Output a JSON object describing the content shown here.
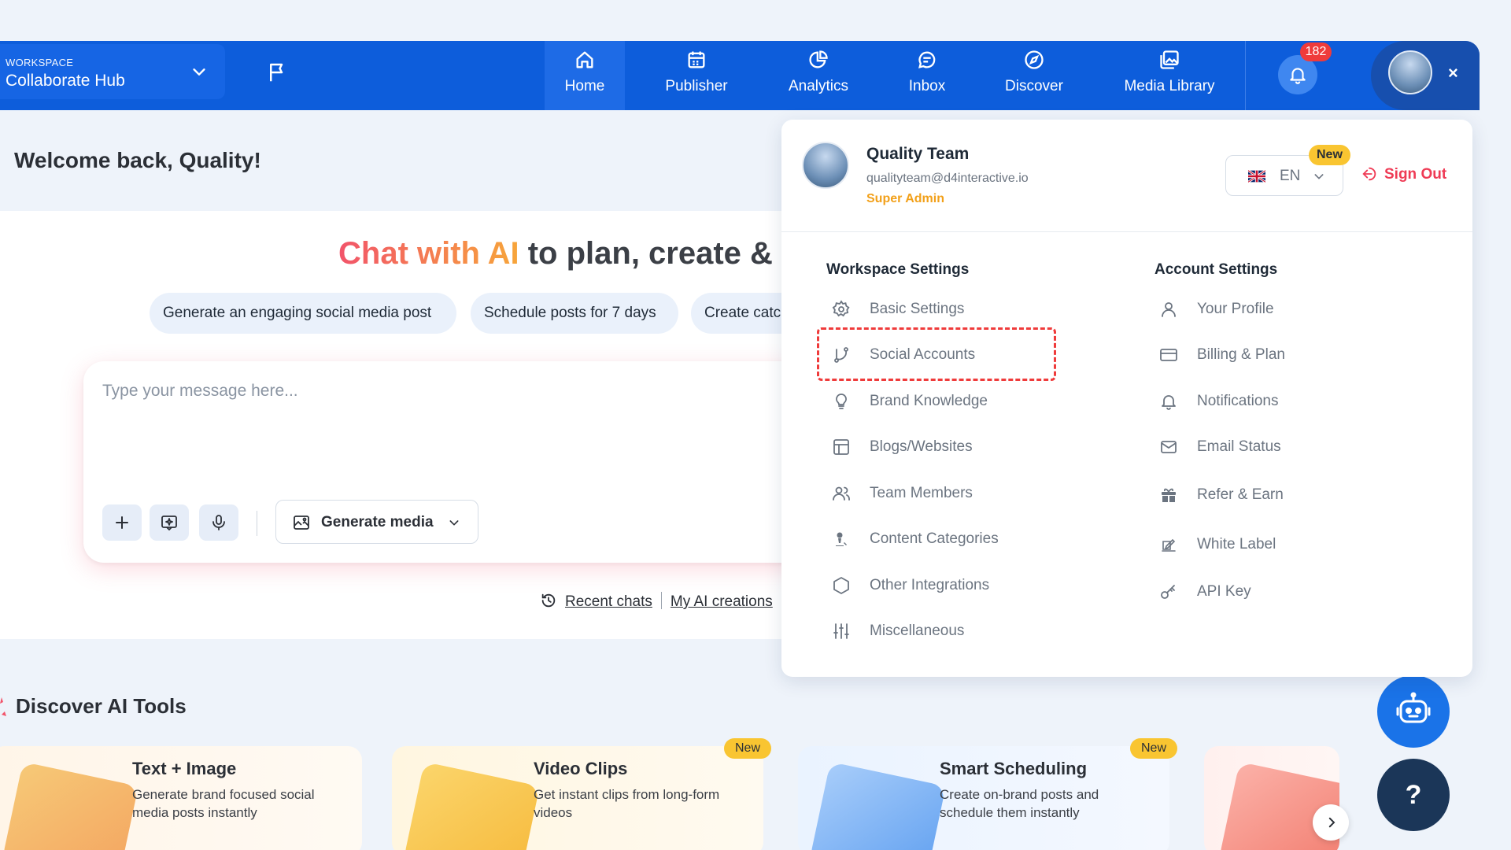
{
  "topbar": {
    "workspace_label": "WORKSPACE",
    "workspace_name": "Collaborate Hub",
    "nav": [
      {
        "label": "Home",
        "icon": "home-icon",
        "active": true
      },
      {
        "label": "Publisher",
        "icon": "calendar-icon"
      },
      {
        "label": "Analytics",
        "icon": "pie-chart-icon"
      },
      {
        "label": "Inbox",
        "icon": "chat-icon"
      },
      {
        "label": "Discover",
        "icon": "compass-icon"
      },
      {
        "label": "Media Library",
        "icon": "image-gallery-icon"
      }
    ],
    "notification_count": "182",
    "close_label": "×"
  },
  "main": {
    "welcome": "Welcome back, Quality!",
    "headline_accent": "Chat with AI",
    "headline_rest": " to plan, create & sc",
    "suggestions": [
      "Generate an engaging social media post",
      "Schedule posts for 7 days",
      "Create catc"
    ],
    "chat_placeholder": "Type your message here...",
    "generate_media_label": "Generate media",
    "recent_chats": "Recent chats",
    "my_ai_creations": "My AI creations"
  },
  "discover": {
    "title": "Discover AI Tools",
    "cards": [
      {
        "title": "Text + Image",
        "desc": "Generate brand focused social media posts instantly",
        "is_new": false
      },
      {
        "title": "Video Clips",
        "desc": "Get instant clips from long-form videos",
        "is_new": true
      },
      {
        "title": "Smart Scheduling",
        "desc": "Create on-brand posts and schedule them instantly",
        "is_new": true
      }
    ],
    "new_label": "New"
  },
  "help_label": "?",
  "dropdown": {
    "user_name": "Quality Team",
    "user_email": "qualityteam@d4interactive.io",
    "user_role": "Super Admin",
    "language_code": "EN",
    "language_new": "New",
    "sign_out": "Sign Out",
    "workspace_settings_title": "Workspace Settings",
    "account_settings_title": "Account Settings",
    "workspace_settings": [
      {
        "label": "Basic Settings",
        "icon": "gear-icon"
      },
      {
        "label": "Social Accounts",
        "icon": "git-branch-icon",
        "highlighted": true
      },
      {
        "label": "Brand Knowledge",
        "icon": "lightbulb-icon"
      },
      {
        "label": "Blogs/Websites",
        "icon": "layout-icon"
      },
      {
        "label": "Team Members",
        "icon": "users-icon"
      },
      {
        "label": "Content Categories",
        "icon": "user-tag-icon"
      },
      {
        "label": "Other Integrations",
        "icon": "hexagon-icon"
      },
      {
        "label": "Miscellaneous",
        "icon": "sliders-icon"
      }
    ],
    "account_settings": [
      {
        "label": "Your Profile",
        "icon": "user-icon"
      },
      {
        "label": "Billing & Plan",
        "icon": "credit-card-icon"
      },
      {
        "label": "Notifications",
        "icon": "bell-icon"
      },
      {
        "label": "Email Status",
        "icon": "mail-icon"
      },
      {
        "label": "Refer & Earn",
        "icon": "gift-icon"
      },
      {
        "label": "White Label",
        "icon": "tag-edit-icon"
      },
      {
        "label": "API Key",
        "icon": "key-icon"
      }
    ]
  },
  "colors": {
    "primary": "#0d5ddb",
    "danger": "#ef3b3b",
    "role": "#f2a019",
    "new_badge": "#f9c531"
  }
}
